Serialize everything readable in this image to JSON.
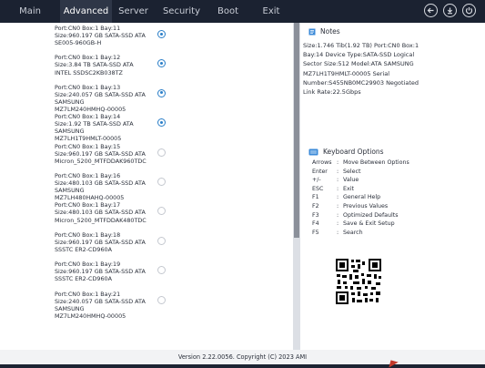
{
  "menu": [
    {
      "label": "Main",
      "active": false
    },
    {
      "label": "Advanced",
      "active": true
    },
    {
      "label": "Server",
      "active": false
    },
    {
      "label": "Security",
      "active": false
    },
    {
      "label": "Boot",
      "active": false
    },
    {
      "label": "Exit",
      "active": false
    }
  ],
  "top_icons": [
    "back-arrow-icon",
    "download-icon",
    "power-icon"
  ],
  "devices": [
    {
      "text": "Port:CN0 Box:1 Bay:11\nSize:960.197 GB SATA-SSD ATA\nSE005-960GB-H",
      "selected": true
    },
    {
      "text": "Port:CN0 Box:1 Bay:12\nSize:3.84 TB SATA-SSD ATA\nINTEL SSDSC2KB038TZ",
      "selected": true
    },
    {
      "text": "Port:CN0 Box:1 Bay:13\nSize:240.057 GB SATA-SSD ATA\nSAMSUNG\nMZ7LM240HMHQ-00005",
      "selected": true
    },
    {
      "text": "Port:CN0 Box:1 Bay:14\nSize:1.92 TB SATA-SSD ATA\nSAMSUNG\nMZ7LH1T9HMLT-00005",
      "selected": true
    },
    {
      "text": "Port:CN0 Box:1 Bay:15\nSize:960.197 GB SATA-SSD ATA\nMicron_5200_MTFDDAK960TDC",
      "selected": false
    },
    {
      "text": "Port:CN0 Box:1 Bay:16\nSize:480.103 GB SATA-SSD ATA\nSAMSUNG\nMZ7LH480HAHQ-00005",
      "selected": false
    },
    {
      "text": "Port:CN0 Box:1 Bay:17\nSize:480.103 GB SATA-SSD ATA\nMicron_5200_MTFDDAK480TDC",
      "selected": false
    },
    {
      "text": "Port:CN0 Box:1 Bay:18\nSize:960.197 GB SATA-SSD ATA\nSSSTC ER2-CD960A",
      "selected": false
    },
    {
      "text": "Port:CN0 Box:1 Bay:19\nSize:960.197 GB SATA-SSD ATA\nSSSTC ER2-CD960A",
      "selected": false
    },
    {
      "text": "Port:CN0 Box:1 Bay:21\nSize:240.057 GB SATA-SSD ATA\nSAMSUNG\nMZ7LM240HMHQ-00005",
      "selected": false
    }
  ],
  "notes": {
    "title": "Notes",
    "lines": [
      "Size:1.746 Tib(1.92 TB) Port:CN0 Box:1",
      "Bay:14 Device Type:SATA-SSD Logical",
      "Sector Size:512 Model:ATA      SAMSUNG",
      "MZ7LH1T9HMLT-00005 Serial",
      "Number:S455NB0MC29903 Negotiated",
      "Link Rate:22.5Gbps"
    ]
  },
  "keyboard": {
    "title": "Keyboard Options",
    "rows": [
      {
        "key": "Arrows",
        "sep": ":",
        "desc": "Move Between Options"
      },
      {
        "key": "Enter",
        "sep": ":",
        "desc": "Select"
      },
      {
        "key": "+/-",
        "sep": ":",
        "desc": "Value"
      },
      {
        "key": "ESC",
        "sep": ":",
        "desc": "Exit"
      },
      {
        "key": "F1",
        "sep": ":",
        "desc": "General Help"
      },
      {
        "key": "F2",
        "sep": ":",
        "desc": "Previous Values"
      },
      {
        "key": "F3",
        "sep": ":",
        "desc": "Optimized Defaults"
      },
      {
        "key": "F4",
        "sep": ":",
        "desc": "Save & Exit Setup"
      },
      {
        "key": "F5",
        "sep": ":",
        "desc": "Search"
      }
    ]
  },
  "footer": {
    "text": "Version 2.22.0056. Copyright (C) 2023 AMI"
  },
  "colors": {
    "topbar": "#1b2231",
    "active_tab": "#2e3647",
    "radio_selected": "#2b7fc8",
    "scroll_thumb": "#8b909a"
  }
}
